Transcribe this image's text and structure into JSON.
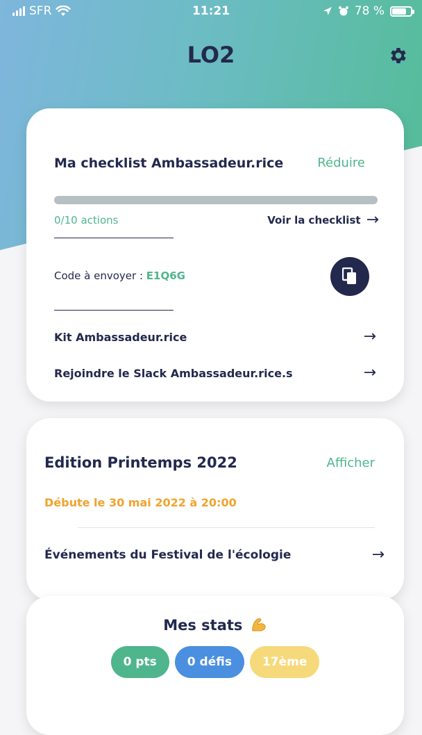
{
  "status_bar": {
    "carrier": "SFR",
    "time": "11:21",
    "battery_text": "78 %",
    "battery_level": 0.78
  },
  "header": {
    "title": "LO2",
    "settings_icon": "gear-icon"
  },
  "checklist_card": {
    "title": "Ma checklist Ambassadeur.rice",
    "collapse_label": "Réduire",
    "progress": 0,
    "progress_text": "0/10 actions",
    "view_link": "Voir la checklist",
    "code_label": "Code à envoyer :",
    "code_value": "E1Q6G",
    "copy_icon": "copy-icon",
    "links": [
      {
        "label": "Kit Ambassadeur.rice"
      },
      {
        "label": "Rejoindre le Slack Ambassadeur.rice.s"
      }
    ]
  },
  "edition_card": {
    "title": "Edition Printemps 2022",
    "show_label": "Afficher",
    "start_text": "Débute le 30 mai 2022 à 20:00",
    "events_link": "Événements du Festival de l'écologie"
  },
  "stats_card": {
    "title": "Mes stats",
    "pills": [
      {
        "label": "0 pts",
        "color": "#4fb58d"
      },
      {
        "label": "0 défis",
        "color": "#4a8fe0"
      },
      {
        "label": "17ème",
        "color": "#f6d97a"
      }
    ]
  },
  "colors": {
    "navy": "#23294d",
    "green": "#4fb58d",
    "orange": "#f0a32e"
  }
}
